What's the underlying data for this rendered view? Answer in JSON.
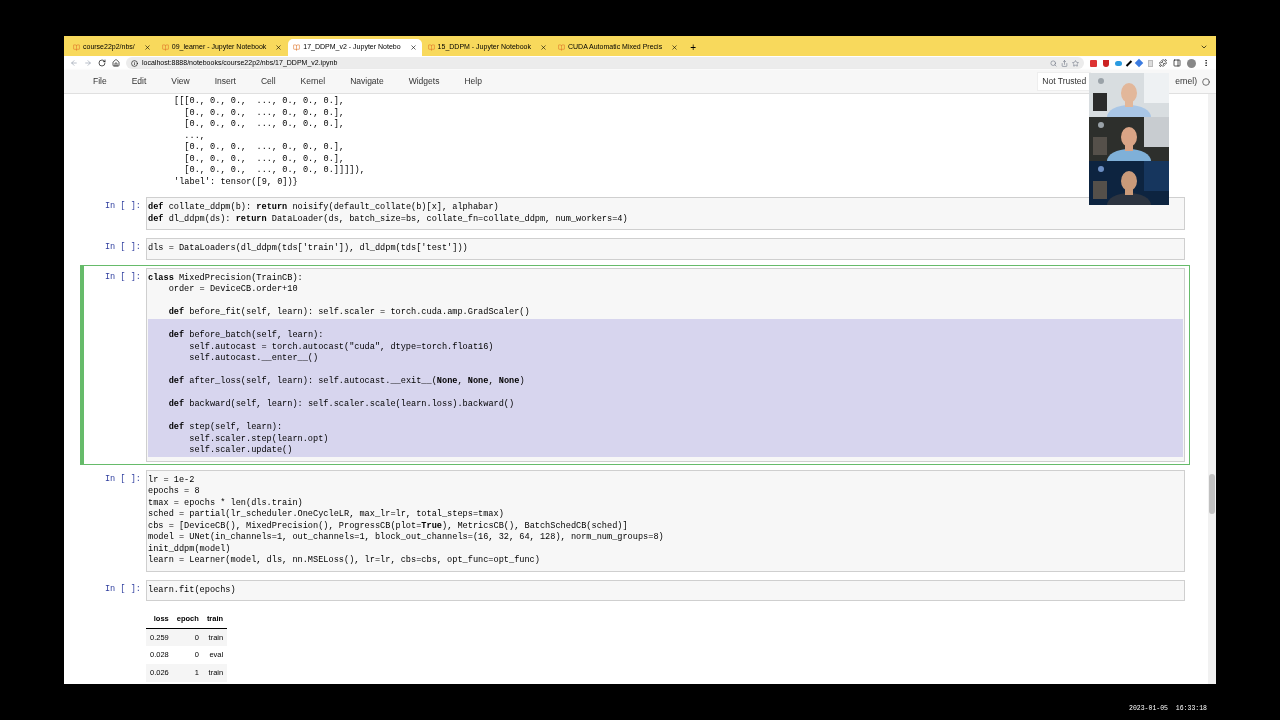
{
  "browser": {
    "tabs": [
      {
        "title": "course22p2/nbs/",
        "selected": false
      },
      {
        "title": "09_learner - Jupyter Notebook",
        "selected": false
      },
      {
        "title": "17_DDPM_v2 - Jupyter Notebo",
        "selected": true
      },
      {
        "title": "15_DDPM - Jupyter Notebook",
        "selected": false
      },
      {
        "title": "CUDA Automatic Mixed Precis",
        "selected": false
      }
    ],
    "new_tab": "+",
    "url": "localhost:8888/notebooks/course22p2/nbs/17_DDPM_v2.ipynb"
  },
  "jupyter": {
    "menu": [
      "File",
      "Edit",
      "View",
      "Insert",
      "Cell",
      "Kernel",
      "Navigate",
      "Widgets",
      "Help"
    ],
    "trust": "Not Trusted",
    "kernel": "ernel)"
  },
  "output_above": [
    "[[[0., 0., 0.,  ..., 0., 0., 0.],",
    "  [0., 0., 0.,  ..., 0., 0., 0.],",
    "  [0., 0., 0.,  ..., 0., 0., 0.],",
    "  ...,",
    "  [0., 0., 0.,  ..., 0., 0., 0.],",
    "  [0., 0., 0.,  ..., 0., 0., 0.],",
    "  [0., 0., 0.,  ..., 0., 0., 0.]]]]),",
    "'label': tensor([9, 0])}"
  ],
  "cells": [
    {
      "prompt": "In [ ]:",
      "selected": false,
      "lines": [
        {
          "text": "**def** collate_ddpm(b): **return** noisify(default_collate(b)[x], alphabar)",
          "selected": false
        },
        {
          "text": "**def** dl_ddpm(ds): **return** DataLoader(ds, batch_size=bs, collate_fn=collate_ddpm, num_workers=4)",
          "selected": false
        }
      ]
    },
    {
      "prompt": "In [ ]:",
      "selected": false,
      "lines": [
        {
          "text": "dls = DataLoaders(dl_ddpm(tds['train']), dl_ddpm(tds['test']))",
          "selected": false
        }
      ]
    },
    {
      "prompt": "In [ ]:",
      "selected": true,
      "lines": [
        {
          "text": "**class** MixedPrecision(TrainCB):",
          "selected": false
        },
        {
          "text": "    order = DeviceCB.order+10",
          "selected": false
        },
        {
          "selected": false
        },
        {
          "text": "    **def** before_fit(self, learn): self.scaler = torch.cuda.amp.GradScaler()",
          "selected": false
        },
        {
          "selected": true
        },
        {
          "text": "    **def** before_batch(self, learn):",
          "selected": true
        },
        {
          "text": "        self.autocast = torch.autocast(\"cuda\", dtype=torch.float16)",
          "selected": true
        },
        {
          "text": "        self.autocast.__enter__()",
          "selected": true
        },
        {
          "selected": true
        },
        {
          "text": "    **def** after_loss(self, learn): self.autocast.__exit__(**None**, **None**, **None**)",
          "selected": true
        },
        {
          "selected": true
        },
        {
          "text": "    **def** backward(self, learn): self.scaler.scale(learn.loss).backward()",
          "selected": true
        },
        {
          "selected": true
        },
        {
          "text": "    **def** step(self, learn):",
          "selected": true
        },
        {
          "text": "        self.scaler.step(learn.opt)",
          "selected": true
        },
        {
          "text": "        self.scaler.update()",
          "selected": true
        }
      ]
    },
    {
      "prompt": "In [ ]:",
      "selected": false,
      "lines": [
        {
          "text": "lr = 1e-2",
          "selected": false
        },
        {
          "text": "epochs = 8",
          "selected": false
        },
        {
          "text": "tmax = epochs * len(dls.train)",
          "selected": false
        },
        {
          "text": "sched = partial(lr_scheduler.OneCycleLR, max_lr=lr, total_steps=tmax)",
          "selected": false
        },
        {
          "text": "cbs = [DeviceCB(), MixedPrecision(), ProgressCB(plot=**True**), MetricsCB(), BatchSchedCB(sched)]",
          "selected": false
        },
        {
          "text": "model = UNet(in_channels=1, out_channels=1, block_out_channels=(16, 32, 64, 128), norm_num_groups=8)",
          "selected": false
        },
        {
          "text": "init_ddpm(model)",
          "selected": false
        },
        {
          "text": "learn = Learner(model, dls, nn.MSELoss(), lr=lr, cbs=cbs, opt_func=opt_func)",
          "selected": false
        }
      ]
    },
    {
      "prompt": "In [ ]:",
      "selected": false,
      "lines": [
        {
          "text": "learn.fit(epochs)",
          "selected": false
        }
      ],
      "table": {
        "columns": [
          "loss",
          "epoch",
          "train"
        ],
        "rows": [
          [
            "0.259",
            "0",
            "train"
          ],
          [
            "0.028",
            "0",
            "eval"
          ],
          [
            "0.026",
            "1",
            "train"
          ]
        ]
      }
    }
  ],
  "video_tiles": [
    {
      "kind": "picture"
    },
    {
      "kind": "picture"
    },
    {
      "kind": "picture"
    }
  ],
  "timestamp": "2023-01-05  16:33:18"
}
